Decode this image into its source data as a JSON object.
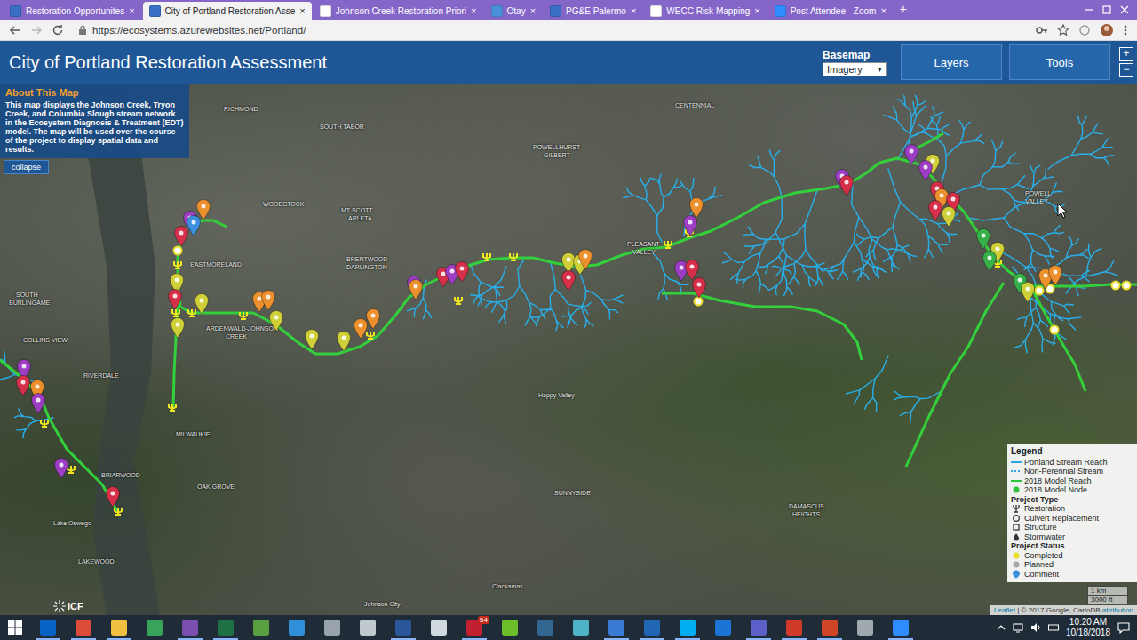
{
  "browser": {
    "tabs": [
      {
        "label": "Restoration Opportunites",
        "selected": false,
        "color": "#3a6fc6"
      },
      {
        "label": "City of Portland Restoration Asse",
        "selected": true,
        "color": "#3a6fc6"
      },
      {
        "label": "Johnson Creek Restoration Priori",
        "selected": false,
        "color": "#ffffff"
      },
      {
        "label": "Otay",
        "selected": false,
        "color": "#4a90d9"
      },
      {
        "label": "PG&E Palermo",
        "selected": false,
        "color": "#3a6fc6"
      },
      {
        "label": "WECC Risk Mapping",
        "selected": false,
        "color": "#ffffff"
      },
      {
        "label": "Post Attendee - Zoom",
        "selected": false,
        "color": "#2d8cff"
      }
    ],
    "close_glyph": "×",
    "new_tab_glyph": "+",
    "url": "https://ecosystems.azurewebsites.net/Portland/"
  },
  "app": {
    "title": "City of Portland Restoration Assessment",
    "basemap": {
      "label": "Basemap",
      "value": "Imagery",
      "caret": "▾"
    },
    "buttons": [
      "Layers",
      "Tools"
    ],
    "zoom": {
      "in": "+",
      "out": "−"
    }
  },
  "about": {
    "title": "About This Map",
    "body": "This map displays the Johnson Creek, Tryon Creek, and Columbia Slough stream network in the Ecosystem Diagnosis & Treatment (EDT) model. The map will be used over the course of the project to display spatial data and results.",
    "button": "collapse"
  },
  "map": {
    "place_labels": [
      "RICHMOND",
      "SOUTH TABOR",
      "CENTENNIAL",
      "POWELLHURST",
      "GILBERT",
      "WOODSTOCK",
      "MT SCOTT",
      "ARLETA",
      "EASTMORELAND",
      "BRENTWOOD",
      "DARLINGTON",
      "ARDENWALD-JOHNSON",
      "CREEK",
      "SOUTH",
      "BURLINGAME",
      "COLLINS VIEW",
      "RIVERDALE",
      "MILWAUKIE",
      "BRIARWOOD",
      "Lake Oswego",
      "LAKEWOOD",
      "OAK GROVE",
      "PLEASANT",
      "VALLEY",
      "Happy Valley",
      "SUNNYSIDE",
      "DAMASCUS",
      "HEIGHTS",
      "Clackamas",
      "Johnson City",
      "POWELL",
      "VALLEY"
    ],
    "pins": [
      {
        "color": "#ec8f2d"
      },
      {
        "color": "#9c3dc4"
      },
      {
        "color": "#3b8fdc"
      },
      {
        "color": "#d52f4a"
      },
      {
        "color": "#cfcf38"
      },
      {
        "color": "#d52f4a"
      },
      {
        "color": "#cfcf38"
      },
      {
        "color": "#ec8f2d"
      },
      {
        "color": "#ec8f2d"
      },
      {
        "color": "#cfcf38"
      },
      {
        "color": "#cfcf38"
      },
      {
        "color": "#cfcf38"
      },
      {
        "color": "#cfcf38"
      },
      {
        "color": "#ec8f2d"
      },
      {
        "color": "#ec8f2d"
      },
      {
        "color": "#9c3dc4"
      },
      {
        "color": "#ec8f2d"
      },
      {
        "color": "#d52f4a"
      },
      {
        "color": "#9c3dc4"
      },
      {
        "color": "#d52f4a"
      },
      {
        "color": "#cfcf38"
      },
      {
        "color": "#cfcf38"
      },
      {
        "color": "#ec8f2d"
      },
      {
        "color": "#d52f4a"
      },
      {
        "color": "#ec8f2d"
      },
      {
        "color": "#9c3dc4"
      },
      {
        "color": "#9c3dc4"
      },
      {
        "color": "#d52f4a"
      },
      {
        "color": "#d52f4a"
      },
      {
        "color": "#9c3dc4"
      },
      {
        "color": "#d52f4a"
      },
      {
        "color": "#9c3dc4"
      },
      {
        "color": "#cfcf38"
      },
      {
        "color": "#9c3dc4"
      },
      {
        "color": "#d52f4a"
      },
      {
        "color": "#ec8f2d"
      },
      {
        "color": "#d52f4a"
      },
      {
        "color": "#d52f4a"
      },
      {
        "color": "#cfcf38"
      },
      {
        "color": "#38b04a"
      },
      {
        "color": "#cfcf38"
      },
      {
        "color": "#38b04a"
      },
      {
        "color": "#38b04a"
      },
      {
        "color": "#cfcf38"
      },
      {
        "color": "#ec8f2d"
      },
      {
        "color": "#ec8f2d"
      },
      {
        "color": "#9c3dc4"
      },
      {
        "color": "#d52f4a"
      },
      {
        "color": "#ec8f2d"
      },
      {
        "color": "#9c3dc4"
      },
      {
        "color": "#9c3dc4"
      },
      {
        "color": "#d52f4a"
      }
    ],
    "logo": "ICF",
    "scale": [
      "1 km",
      "3000 ft"
    ],
    "attribution": [
      {
        "text": "Leaflet",
        "link": true
      },
      {
        "text": " | © 2017 Google, CartoDB ",
        "link": false
      },
      {
        "text": "attribution",
        "link": true
      }
    ]
  },
  "legend": {
    "title": "Legend",
    "items": [
      {
        "label": "Portland Stream Reach",
        "kind": "line",
        "color": "#2aa6e6"
      },
      {
        "label": "Non-Perennial Stream",
        "kind": "dashed",
        "color": "#2aa6e6"
      },
      {
        "label": "2018 Model Reach",
        "kind": "line",
        "color": "#2fc43a"
      },
      {
        "label": "2018 Model Node",
        "kind": "dot",
        "color": "#2fc43a"
      },
      {
        "label": "Project Type",
        "kind": "heading"
      },
      {
        "label": "Restoration",
        "kind": "restoration"
      },
      {
        "label": "Culvert Replacement",
        "kind": "culvert"
      },
      {
        "label": "Structure",
        "kind": "structure"
      },
      {
        "label": "Stormwater",
        "kind": "stormwater"
      },
      {
        "label": "Project Status",
        "kind": "heading"
      },
      {
        "label": "Completed",
        "kind": "dot",
        "color": "#e8dc2a"
      },
      {
        "label": "Planned",
        "kind": "dot",
        "color": "#a8a8a8"
      },
      {
        "label": "Comment",
        "kind": "pin",
        "color": "#3b8fdc"
      }
    ]
  },
  "taskbar": {
    "apps": [
      {
        "color": "#0a64c8",
        "running": true
      },
      {
        "color": "#dd4b39",
        "running": true
      },
      {
        "color": "#f0c040",
        "running": true
      },
      {
        "color": "#3aa35a",
        "running": false
      },
      {
        "color": "#7b4fb0",
        "running": true
      },
      {
        "color": "#1e7145",
        "running": true
      },
      {
        "color": "#5aa040",
        "running": false
      },
      {
        "color": "#2f8fd8",
        "running": false
      },
      {
        "color": "#9aa3ad",
        "running": false
      },
      {
        "color": "#c0c8d0",
        "running": false
      },
      {
        "color": "#2b579a",
        "running": true
      },
      {
        "color": "#d0d8e0",
        "running": false
      },
      {
        "color": "#c02030",
        "running": true,
        "badge": "54"
      },
      {
        "color": "#6cbf2a",
        "running": false
      },
      {
        "color": "#336791",
        "running": false
      },
      {
        "color": "#4fb3c8",
        "running": false
      },
      {
        "color": "#3a7bd5",
        "running": true
      },
      {
        "color": "#2165b6",
        "running": true
      },
      {
        "color": "#00aff0",
        "running": true
      },
      {
        "color": "#1c75d4",
        "running": false
      },
      {
        "color": "#5b5fc7",
        "running": true
      },
      {
        "color": "#d03a2a",
        "running": true
      },
      {
        "color": "#d04525",
        "running": true
      },
      {
        "color": "#a0a8b0",
        "running": false
      },
      {
        "color": "#2d8cff",
        "running": true
      }
    ],
    "time": "10:20 AM",
    "date": "10/18/2018"
  }
}
